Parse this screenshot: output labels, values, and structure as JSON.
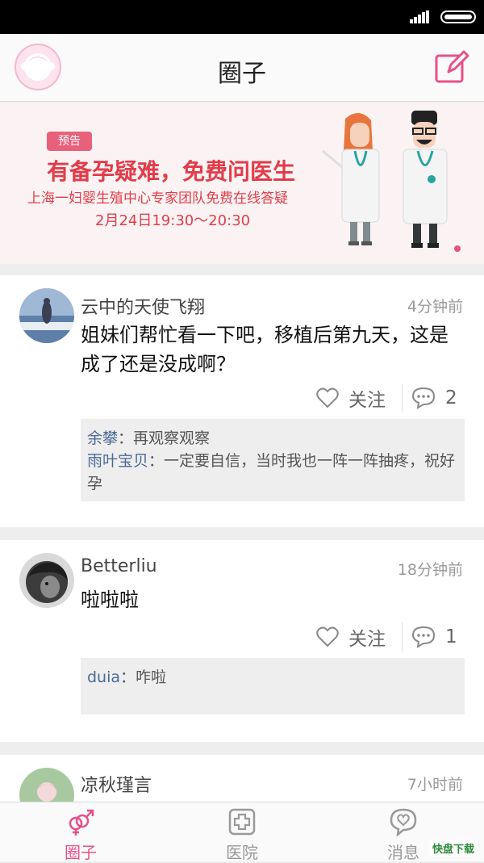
{
  "header": {
    "title": "圈子"
  },
  "banner": {
    "badge": "预告",
    "title": "有备孕疑难，免费问医生",
    "subtitle": "上海一妇婴生殖中心专家团队免费在线答疑",
    "time": "2月24日19:30～20:30"
  },
  "posts": [
    {
      "author": "云中的天使飞翔",
      "time": "4分钟前",
      "text": "姐妹们帮忙看一下吧，移植后第九天，这是成了还是没成啊？",
      "follow_label": "关注",
      "comment_count": "2",
      "comments": [
        {
          "author": "余攀",
          "sep": "：",
          "text": "再观察观察"
        },
        {
          "author": "雨叶宝贝",
          "sep": "：",
          "text": "一定要自信，当时我也一阵一阵抽疼，祝好孕"
        }
      ]
    },
    {
      "author": "Betterliu",
      "time": "18分钟前",
      "text": "啦啦啦",
      "follow_label": "关注",
      "comment_count": "1",
      "comments": [
        {
          "author": "duia",
          "sep": "：",
          "text": "咋啦"
        }
      ]
    },
    {
      "author": "凉秋瑾言",
      "time": "7小时前"
    }
  ],
  "tabs": [
    {
      "label": "圈子",
      "icon": "gender-icon",
      "active": true
    },
    {
      "label": "医院",
      "icon": "hospital-icon",
      "active": false
    },
    {
      "label": "消息",
      "icon": "message-heart-icon",
      "active": false
    }
  ],
  "watermark": "快盘下载",
  "colors": {
    "accent": "#e8508a",
    "banner_red": "#e23c4a",
    "comment_author": "#4d6a96",
    "tab_inactive": "#999999"
  }
}
